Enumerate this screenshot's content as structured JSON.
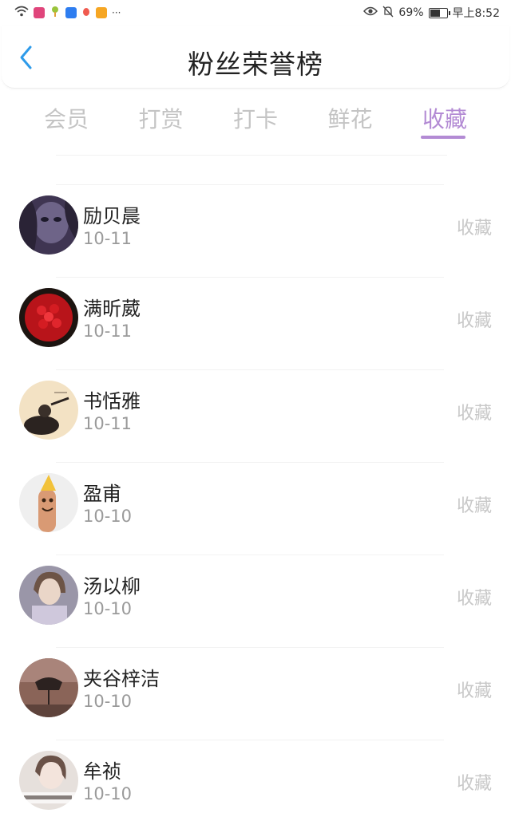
{
  "status_bar": {
    "battery": "69%",
    "battery_level": 0.69,
    "time": "早上8:52",
    "more": "···",
    "icons": [
      "wifi-icon",
      "mail-app-icon",
      "plant-app-icon",
      "chat-app-icon",
      "paw-app-icon",
      "play-app-icon",
      "eye-icon",
      "bell-off-icon",
      "battery-icon"
    ]
  },
  "header": {
    "title": "粉丝荣誉榜",
    "back_icon": "chevron-left-icon"
  },
  "tabs": [
    {
      "label": "会员",
      "active": false
    },
    {
      "label": "打赏",
      "active": false
    },
    {
      "label": "打卡",
      "active": false
    },
    {
      "label": "鲜花",
      "active": false
    },
    {
      "label": "收藏",
      "active": true
    }
  ],
  "colors": {
    "accent": "#b38bd4",
    "back": "#2e9bea",
    "tab_inactive": "#c4c4c4",
    "action_text": "#c8c8c8",
    "date_text": "#9a9a9a"
  },
  "fans": [
    {
      "name": "励贝晨",
      "date": "10-11",
      "action": "收藏"
    },
    {
      "name": "满昕葳",
      "date": "10-11",
      "action": "收藏"
    },
    {
      "name": "书恬雅",
      "date": "10-11",
      "action": "收藏"
    },
    {
      "name": "盈甫",
      "date": "10-10",
      "action": "收藏"
    },
    {
      "name": "汤以柳",
      "date": "10-10",
      "action": "收藏"
    },
    {
      "name": "夹谷梓洁",
      "date": "10-10",
      "action": "收藏"
    },
    {
      "name": "牟祯",
      "date": "10-10",
      "action": "收藏"
    }
  ]
}
